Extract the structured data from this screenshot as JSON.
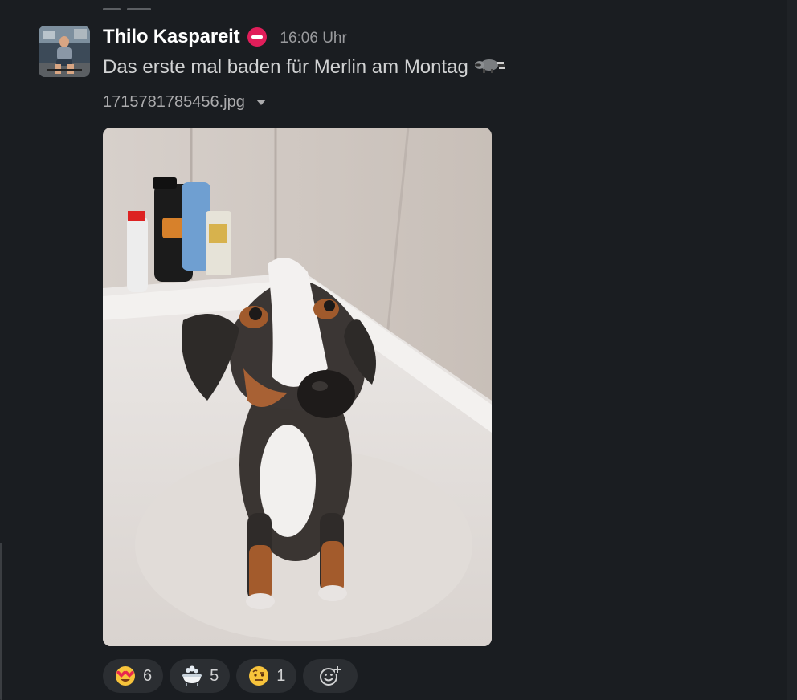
{
  "message": {
    "author": "Thilo Kaspareit",
    "status_icon": "do-not-disturb-icon",
    "time": "16:06 Uhr",
    "text": "Das erste mal baden für Merlin am Montag",
    "text_emoji": "raccoon-icon",
    "file_name": "1715781785456.jpg"
  },
  "reactions": [
    {
      "emoji": "heart-eyes-icon",
      "count": "6"
    },
    {
      "emoji": "bathtub-icon",
      "count": "5"
    },
    {
      "emoji": "raised-eyebrow-icon",
      "count": "1"
    }
  ],
  "colors": {
    "background": "#1a1d21",
    "author": "#ffffff",
    "status": "#e01e5a",
    "reaction_bg": "#2b2e32"
  }
}
